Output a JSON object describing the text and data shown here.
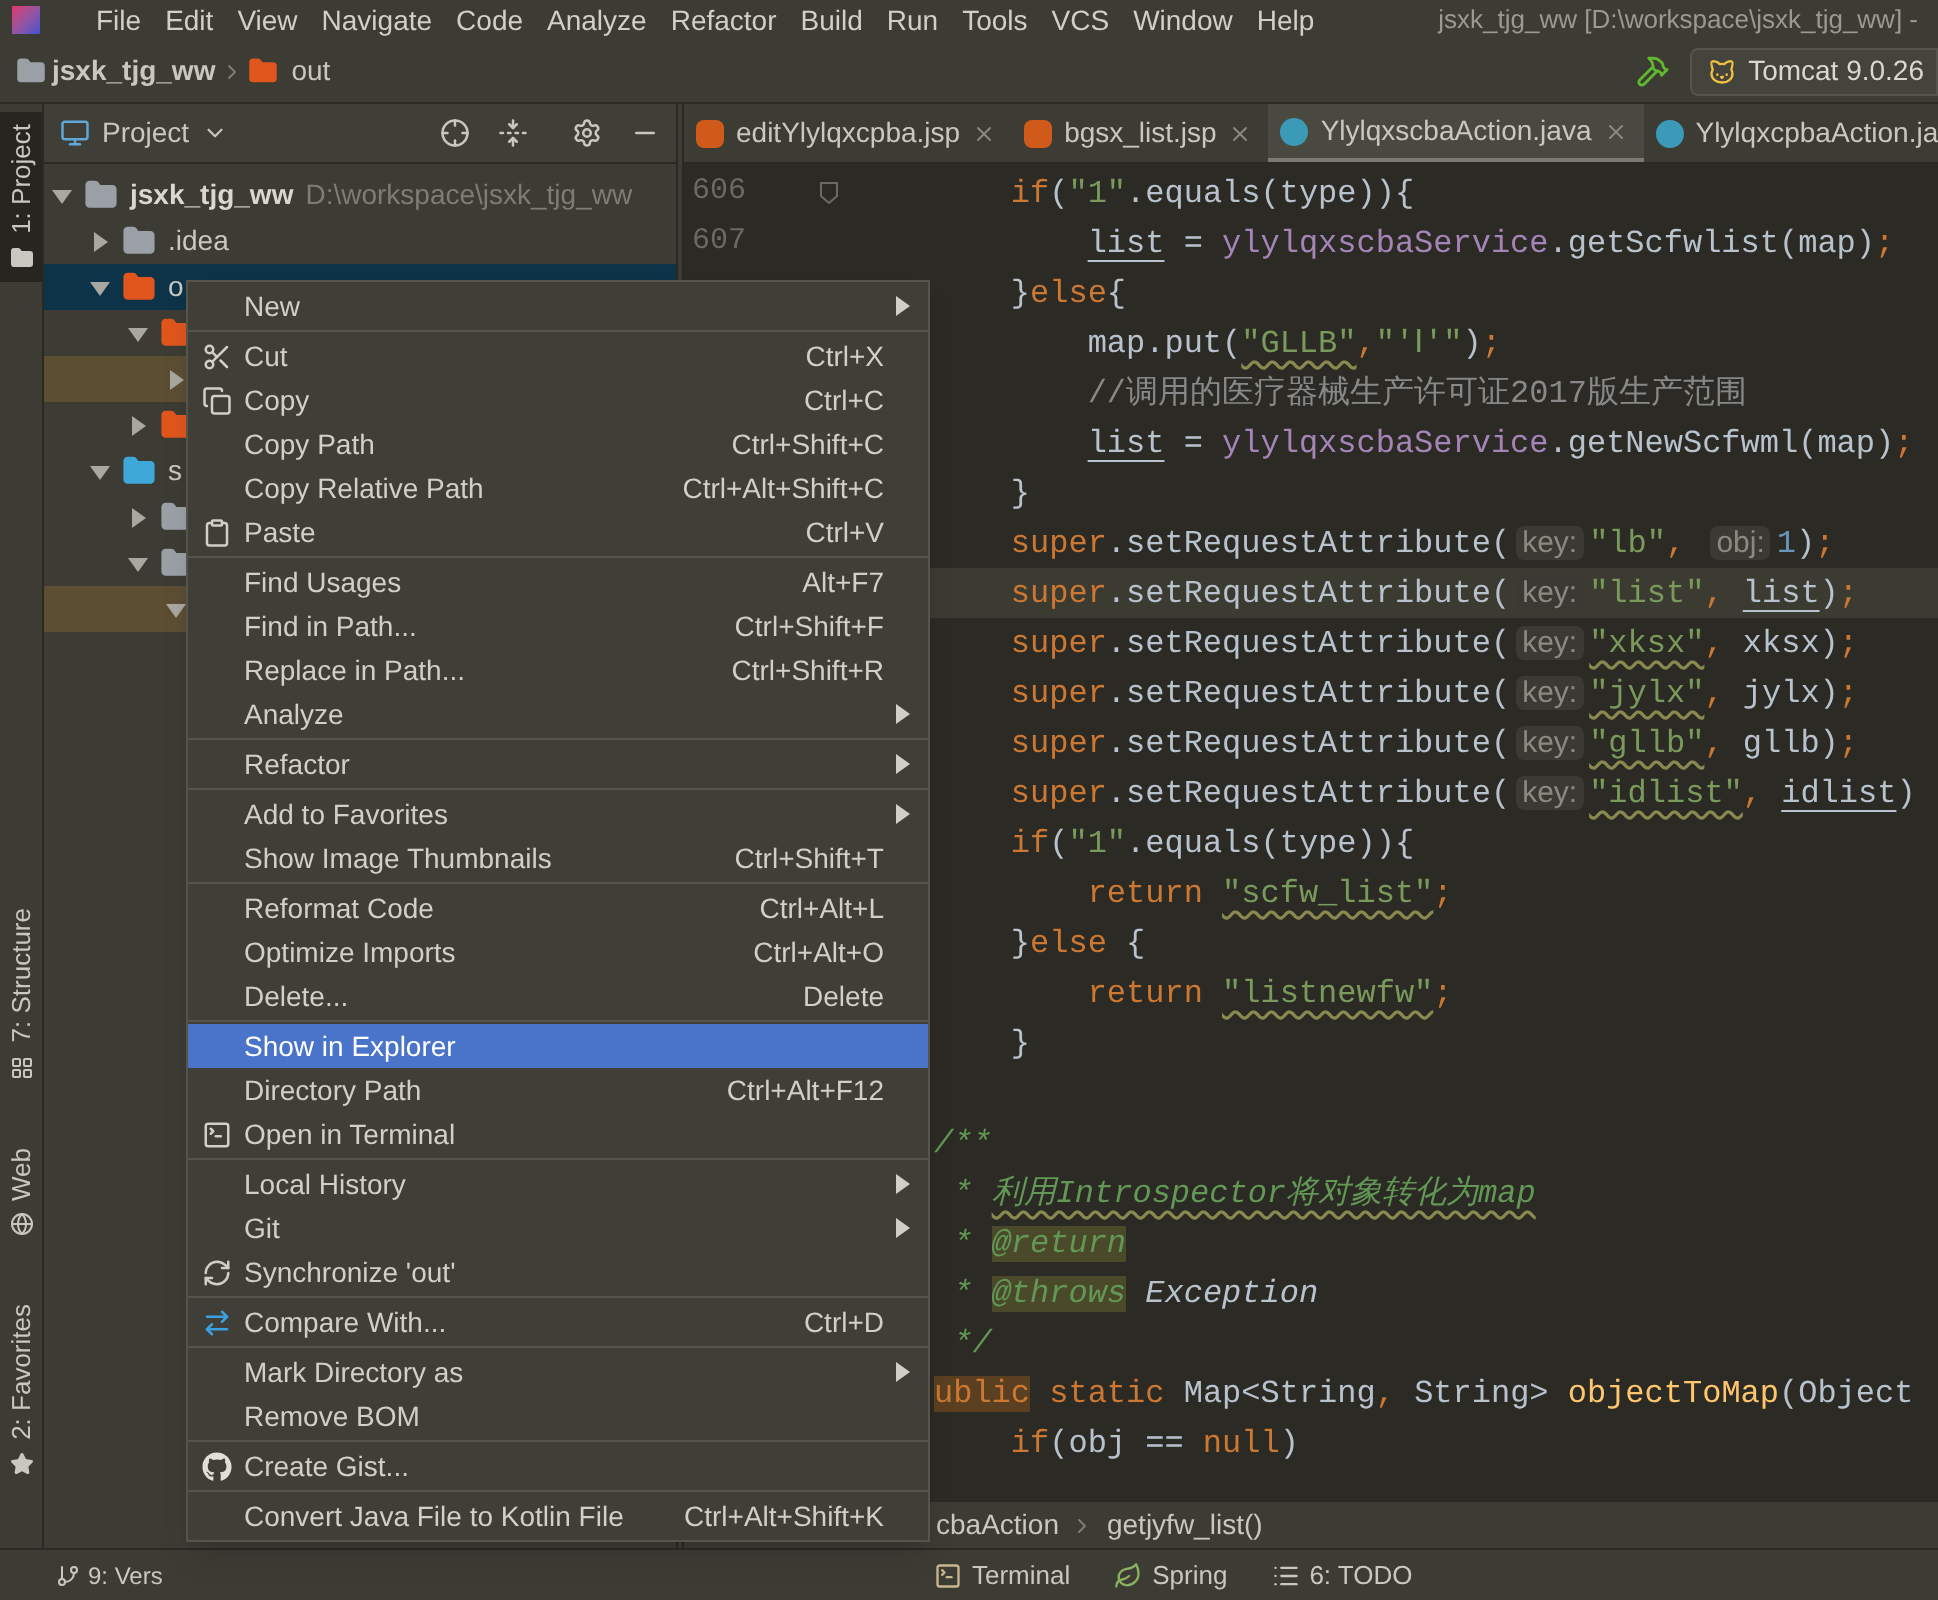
{
  "menu_bar": {
    "items": [
      "File",
      "Edit",
      "View",
      "Navigate",
      "Code",
      "Analyze",
      "Refactor",
      "Build",
      "Run",
      "Tools",
      "VCS",
      "Window",
      "Help"
    ],
    "title": "jsxk_tjg_ww [D:\\workspace\\jsxk_tjg_ww] -"
  },
  "nav_bar": {
    "crumbs": [
      "jsxk_tjg_ww",
      "out"
    ],
    "run_config": "Tomcat 9.0.26"
  },
  "left_strip": {
    "top": [
      {
        "label": "1: Project",
        "selected": true
      }
    ],
    "bottom": [
      {
        "label": "7: Structure",
        "selected": false
      },
      {
        "label": "Web",
        "selected": false
      },
      {
        "label": "2: Favorites",
        "selected": false
      }
    ]
  },
  "project_panel": {
    "title": "Project",
    "tree": [
      {
        "label": "jsxk_tjg_ww",
        "path": "D:\\workspace\\jsxk_tjg_ww",
        "expanded": true,
        "selected": false,
        "color": "#9aa0a6",
        "children": [
          {
            "label": ".idea",
            "expanded": false,
            "selected": false,
            "color": "#9aa0a6"
          },
          {
            "label": "o",
            "expanded": true,
            "selected": true,
            "color": "#e0561d",
            "children": [
              {
                "expanded": true,
                "selected": false,
                "color": "#e0561d",
                "children": [
                  {
                    "expanded": false,
                    "selected": false
                  }
                ]
              },
              {
                "expanded": false,
                "selected": false,
                "color": "#e0561d"
              }
            ]
          },
          {
            "label": "s",
            "expanded": true,
            "selected": false,
            "color": "#3ea8d8",
            "children": [
              {
                "expanded": false,
                "selected": false,
                "color": "#9aa0a6"
              },
              {
                "expanded": true,
                "selected": false,
                "color": "#9aa0a6",
                "children": [
                  {
                    "expanded": true,
                    "selected": false
                  }
                ]
              }
            ]
          }
        ]
      }
    ]
  },
  "tabs": [
    {
      "label": "editYlylqxcpba.jsp",
      "kind": "jsp",
      "selected": false,
      "closable": true
    },
    {
      "label": "bgsx_list.jsp",
      "kind": "jsp",
      "selected": false,
      "closable": true
    },
    {
      "label": "YlylqxscbaAction.java",
      "kind": "java",
      "selected": true,
      "closable": true
    },
    {
      "label": "YlylqxcpbaAction.ja",
      "kind": "java",
      "selected": false,
      "closable": false
    }
  ],
  "code": [
    {
      "number": "606",
      "current": false,
      "tokens": [
        {
          "text": "    if",
          "kind": "kw"
        },
        {
          "text": "(",
          "kind": "plain"
        },
        {
          "text": "\"1\"",
          "kind": "str"
        },
        {
          "text": ".equals(type)){",
          "kind": "plain"
        }
      ]
    },
    {
      "number": "607",
      "current": false,
      "tokens": [
        {
          "text": "        list",
          "kind": "plain",
          "reassigned": true
        },
        {
          "text": " = ",
          "kind": "plain"
        },
        {
          "text": "ylylqxscbaService",
          "kind": "field"
        },
        {
          "text": ".getScfwlist(map)",
          "kind": "plain"
        },
        {
          "text": ";",
          "kind": "kw"
        }
      ]
    },
    {
      "current": false,
      "tokens": [
        {
          "text": "    }",
          "kind": "plain"
        },
        {
          "text": "else",
          "kind": "kw"
        },
        {
          "text": "{",
          "kind": "plain"
        }
      ]
    },
    {
      "current": false,
      "tokens": [
        {
          "text": "        map.put(",
          "kind": "plain"
        },
        {
          "text": "\"GLLB\"",
          "kind": "str",
          "typo": true
        },
        {
          "text": ",",
          "kind": "kw"
        },
        {
          "text": "\"'Ⅰ'\"",
          "kind": "str"
        },
        {
          "text": ")",
          "kind": "plain"
        },
        {
          "text": ";",
          "kind": "kw"
        }
      ]
    },
    {
      "current": false,
      "tokens": [
        {
          "text": "        //调用的医疗器械生产许可证2017版生产范围",
          "kind": "comment"
        }
      ]
    },
    {
      "current": false,
      "tokens": [
        {
          "text": "        list",
          "kind": "plain",
          "reassigned": true
        },
        {
          "text": " = ",
          "kind": "plain"
        },
        {
          "text": "ylylqxscbaService",
          "kind": "field"
        },
        {
          "text": ".getNewScfwml(map)",
          "kind": "plain"
        },
        {
          "text": ";",
          "kind": "kw"
        }
      ]
    },
    {
      "current": false,
      "tokens": [
        {
          "text": "    }",
          "kind": "plain"
        }
      ]
    },
    {
      "current": false,
      "tokens": [
        {
          "text": "    super",
          "kind": "kw"
        },
        {
          "text": ".setRequestAttribute(",
          "kind": "plain"
        },
        {
          "text": "key:",
          "kind": "hint"
        },
        {
          "text": "\"lb\"",
          "kind": "str"
        },
        {
          "text": ", ",
          "kind": "kw"
        },
        {
          "text": "obj:",
          "kind": "hint"
        },
        {
          "text": "1",
          "kind": "num"
        },
        {
          "text": ")",
          "kind": "plain"
        },
        {
          "text": ";",
          "kind": "kw"
        }
      ]
    },
    {
      "current": true,
      "tokens": [
        {
          "text": "    super",
          "kind": "kw"
        },
        {
          "text": ".setRequestAttribute(",
          "kind": "plain"
        },
        {
          "text": "key:",
          "kind": "hint"
        },
        {
          "text": "\"list\"",
          "kind": "str"
        },
        {
          "text": ", ",
          "kind": "kw"
        },
        {
          "text": "list",
          "kind": "plain",
          "reassigned": true
        },
        {
          "text": ")",
          "kind": "plain"
        },
        {
          "text": ";",
          "kind": "kw"
        }
      ]
    },
    {
      "current": false,
      "tokens": [
        {
          "text": "    super",
          "kind": "kw"
        },
        {
          "text": ".setRequestAttribute(",
          "kind": "plain"
        },
        {
          "text": "key:",
          "kind": "hint"
        },
        {
          "text": "\"xksx\"",
          "kind": "str",
          "typo": true
        },
        {
          "text": ", ",
          "kind": "kw"
        },
        {
          "text": "xksx)",
          "kind": "plain"
        },
        {
          "text": ";",
          "kind": "kw"
        }
      ]
    },
    {
      "current": false,
      "tokens": [
        {
          "text": "    super",
          "kind": "kw"
        },
        {
          "text": ".setRequestAttribute(",
          "kind": "plain"
        },
        {
          "text": "key:",
          "kind": "hint"
        },
        {
          "text": "\"jylx\"",
          "kind": "str",
          "typo": true
        },
        {
          "text": ", ",
          "kind": "kw"
        },
        {
          "text": "jylx)",
          "kind": "plain"
        },
        {
          "text": ";",
          "kind": "kw"
        }
      ]
    },
    {
      "current": false,
      "tokens": [
        {
          "text": "    super",
          "kind": "kw"
        },
        {
          "text": ".setRequestAttribute(",
          "kind": "plain"
        },
        {
          "text": "key:",
          "kind": "hint"
        },
        {
          "text": "\"gllb\"",
          "kind": "str",
          "typo": true
        },
        {
          "text": ", ",
          "kind": "kw"
        },
        {
          "text": "gllb)",
          "kind": "plain"
        },
        {
          "text": ";",
          "kind": "kw"
        }
      ]
    },
    {
      "current": false,
      "tokens": [
        {
          "text": "    super",
          "kind": "kw"
        },
        {
          "text": ".setRequestAttribute(",
          "kind": "plain"
        },
        {
          "text": "key:",
          "kind": "hint"
        },
        {
          "text": "\"idlist\"",
          "kind": "str",
          "typo": true
        },
        {
          "text": ", ",
          "kind": "kw"
        },
        {
          "text": "idlist",
          "kind": "plain",
          "reassigned": true
        },
        {
          "text": ")",
          "kind": "plain"
        }
      ]
    },
    {
      "current": false,
      "tokens": [
        {
          "text": "    if",
          "kind": "kw"
        },
        {
          "text": "(",
          "kind": "plain"
        },
        {
          "text": "\"1\"",
          "kind": "str"
        },
        {
          "text": ".equals(type)){",
          "kind": "plain"
        }
      ]
    },
    {
      "current": false,
      "tokens": [
        {
          "text": "        return ",
          "kind": "kw"
        },
        {
          "text": "\"scfw_list\"",
          "kind": "str",
          "typo": true
        },
        {
          "text": ";",
          "kind": "kw"
        }
      ]
    },
    {
      "current": false,
      "tokens": [
        {
          "text": "    }",
          "kind": "plain"
        },
        {
          "text": "else",
          "kind": "kw"
        },
        {
          "text": " {",
          "kind": "plain"
        }
      ]
    },
    {
      "current": false,
      "tokens": [
        {
          "text": "        return ",
          "kind": "kw"
        },
        {
          "text": "\"listnewfw\"",
          "kind": "str",
          "typo": true
        },
        {
          "text": ";",
          "kind": "kw"
        }
      ]
    },
    {
      "current": false,
      "tokens": [
        {
          "text": "    }",
          "kind": "plain"
        }
      ]
    },
    {
      "current": false
    },
    {
      "current": false,
      "tokens": [
        {
          "text": "/**",
          "kind": "doc"
        }
      ]
    },
    {
      "current": false,
      "tokens": [
        {
          "text": " * ",
          "kind": "doc"
        },
        {
          "text": "利用Introspector将对象转化为map",
          "kind": "doc",
          "typo": true
        }
      ]
    },
    {
      "current": false,
      "tokens": [
        {
          "text": " * ",
          "kind": "doc"
        },
        {
          "text": "@return",
          "kind": "doctag"
        }
      ]
    },
    {
      "current": false,
      "tokens": [
        {
          "text": " * ",
          "kind": "doc"
        },
        {
          "text": "@throws",
          "kind": "doctag"
        },
        {
          "text": " Exception",
          "kind": "docplain"
        }
      ]
    },
    {
      "current": false,
      "tokens": [
        {
          "text": " */",
          "kind": "doc"
        }
      ]
    },
    {
      "current": false,
      "tokens": [
        {
          "text": "ublic",
          "kind": "kwhl"
        },
        {
          "text": " static ",
          "kind": "kw"
        },
        {
          "text": "Map<String",
          "kind": "plain"
        },
        {
          "text": ", ",
          "kind": "kw"
        },
        {
          "text": "String> ",
          "kind": "plain"
        },
        {
          "text": "objectToMap",
          "kind": "decl"
        },
        {
          "text": "(Object",
          "kind": "plain"
        }
      ]
    },
    {
      "current": false,
      "tokens": [
        {
          "text": "    if",
          "kind": "kw"
        },
        {
          "text": "(obj == ",
          "kind": "plain"
        },
        {
          "text": "null",
          "kind": "kw"
        },
        {
          "text": ")",
          "kind": "plain"
        }
      ]
    }
  ],
  "editor_breadcrumb": [
    "cbaAction",
    "getjyfw_list()"
  ],
  "bottom_tools": {
    "left": [
      "9: Vers"
    ],
    "right": [
      "Terminal",
      "Spring",
      "6: TODO"
    ]
  },
  "context_menu": [
    [
      {
        "label": "New",
        "submenu": true,
        "selected": false
      }
    ],
    [
      {
        "label": "Cut",
        "shortcut": "Ctrl+X",
        "submenu": false,
        "selected": false
      },
      {
        "label": "Copy",
        "shortcut": "Ctrl+C",
        "submenu": false,
        "selected": false
      },
      {
        "label": "Copy Path",
        "shortcut": "Ctrl+Shift+C",
        "submenu": false,
        "selected": false
      },
      {
        "label": "Copy Relative Path",
        "shortcut": "Ctrl+Alt+Shift+C",
        "submenu": false,
        "selected": false
      },
      {
        "label": "Paste",
        "shortcut": "Ctrl+V",
        "submenu": false,
        "selected": false
      }
    ],
    [
      {
        "label": "Find Usages",
        "shortcut": "Alt+F7",
        "submenu": false,
        "selected": false
      },
      {
        "label": "Find in Path...",
        "shortcut": "Ctrl+Shift+F",
        "submenu": false,
        "selected": false
      },
      {
        "label": "Replace in Path...",
        "shortcut": "Ctrl+Shift+R",
        "submenu": false,
        "selected": false
      },
      {
        "label": "Analyze",
        "submenu": true,
        "selected": false
      }
    ],
    [
      {
        "label": "Refactor",
        "submenu": true,
        "selected": false
      }
    ],
    [
      {
        "label": "Add to Favorites",
        "submenu": true,
        "selected": false
      },
      {
        "label": "Show Image Thumbnails",
        "shortcut": "Ctrl+Shift+T",
        "submenu": false,
        "selected": false
      }
    ],
    [
      {
        "label": "Reformat Code",
        "shortcut": "Ctrl+Alt+L",
        "submenu": false,
        "selected": false
      },
      {
        "label": "Optimize Imports",
        "shortcut": "Ctrl+Alt+O",
        "submenu": false,
        "selected": false
      },
      {
        "label": "Delete...",
        "shortcut": "Delete",
        "submenu": false,
        "selected": false
      }
    ],
    [
      {
        "label": "Show in Explorer",
        "submenu": false,
        "selected": true
      },
      {
        "label": "Directory Path",
        "shortcut": "Ctrl+Alt+F12",
        "submenu": false,
        "selected": false
      },
      {
        "label": "Open in Terminal",
        "submenu": false,
        "selected": false
      }
    ],
    [
      {
        "label": "Local History",
        "submenu": true,
        "selected": false
      },
      {
        "label": "Git",
        "submenu": true,
        "selected": false
      },
      {
        "label": "Synchronize 'out'",
        "submenu": false,
        "selected": false
      }
    ],
    [
      {
        "label": "Compare With...",
        "shortcut": "Ctrl+D",
        "submenu": false,
        "selected": false
      }
    ],
    [
      {
        "label": "Mark Directory as",
        "submenu": true,
        "selected": false
      },
      {
        "label": "Remove BOM",
        "submenu": false,
        "selected": false
      }
    ],
    [
      {
        "label": "Create Gist...",
        "submenu": false,
        "selected": false
      }
    ],
    [
      {
        "label": "Convert Java File to Kotlin File",
        "shortcut": "Ctrl+Alt+Shift+K",
        "submenu": false,
        "selected": false
      }
    ]
  ]
}
